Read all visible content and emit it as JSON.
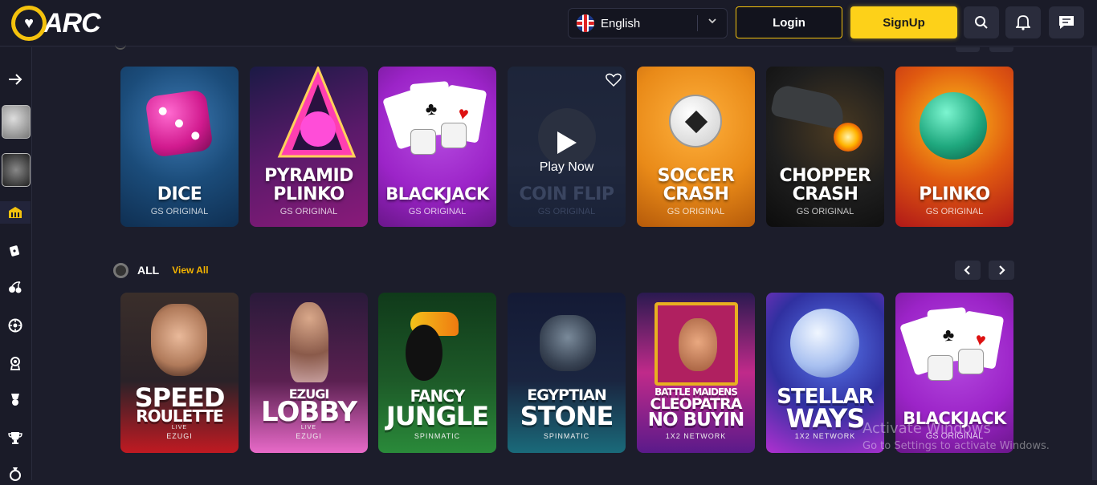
{
  "header": {
    "logo_text": "ARC",
    "language": "English",
    "login_label": "Login",
    "signup_label": "SignUp"
  },
  "sidebar": {
    "items": [
      {
        "icon": "arrow-right-icon"
      },
      {
        "icon": "recent-game-thumb-dice"
      },
      {
        "icon": "recent-game-thumb-ball"
      },
      {
        "icon": "casino-icon"
      },
      {
        "icon": "poker-card-icon"
      },
      {
        "icon": "cherry-slot-icon"
      },
      {
        "icon": "roulette-icon"
      },
      {
        "icon": "live-dealer-icon"
      },
      {
        "icon": "rank-icon"
      },
      {
        "icon": "trophy-icon"
      },
      {
        "icon": "promo-icon"
      }
    ]
  },
  "originals": {
    "cards": [
      {
        "title_line1": "",
        "title_line2": "DICE",
        "subtitle": "GS ORIGINAL",
        "bg": "#1b4c7a"
      },
      {
        "title_line1": "PYRAMID",
        "title_line2": "PLINKO",
        "subtitle": "GS ORIGINAL",
        "bg": "#5a1a6a"
      },
      {
        "title_line1": "",
        "title_line2": "BLACKJACK",
        "subtitle": "GS ORIGINAL",
        "bg": "#9c24c8"
      },
      {
        "title_line1": "",
        "title_line2": "COIN FLIP",
        "subtitle": "GS ORIGINAL",
        "bg": "#2a3550",
        "hover_label": "Play Now"
      },
      {
        "title_line1": "SOCCER",
        "title_line2": "CRASH",
        "subtitle": "GS ORIGINAL",
        "bg": "#e98a18"
      },
      {
        "title_line1": "CHOPPER",
        "title_line2": "CRASH",
        "subtitle": "GS ORIGINAL",
        "bg": "#1e1e1e"
      },
      {
        "title_line1": "",
        "title_line2": "PLINKO",
        "subtitle": "GS ORIGINAL",
        "bg": "#c43012"
      }
    ]
  },
  "all_section": {
    "title": "ALL",
    "view_all": "View All",
    "cards": [
      {
        "line1": "SPEED",
        "line2": "ROULETTE",
        "live": "LIVE",
        "provider": "EZUGI",
        "bg": "#2a2228"
      },
      {
        "line1": "EZUGI",
        "line2": "LOBBY",
        "live": "LIVE",
        "provider": "EZUGI",
        "bg": "#5a2050"
      },
      {
        "line1": "FANCY",
        "line2": "JUNGLE",
        "live": "",
        "provider": "SPINMATIC",
        "bg": "#1d5a28"
      },
      {
        "line1": "EGYPTIAN",
        "line2": "STONE",
        "live": "",
        "provider": "SPINMATIC",
        "bg": "#1a2540"
      },
      {
        "line1": "BATTLE MAIDENS",
        "line2": "CLEOPATRA",
        "line3": "NO BUYIN",
        "live": "",
        "provider": "1X2 NETWORK",
        "bg": "#c02a8a"
      },
      {
        "line1": "STELLAR",
        "line2": "WAYS",
        "live": "",
        "provider": "1X2 NETWORK",
        "bg": "#3030a0"
      },
      {
        "line1": "",
        "line2": "BLACKJACK",
        "live": "",
        "provider": "GS ORIGINAL",
        "bg": "#9c24c8"
      }
    ]
  },
  "watermark": {
    "line1": "Activate Windows",
    "line2": "Go to Settings to activate Windows."
  }
}
